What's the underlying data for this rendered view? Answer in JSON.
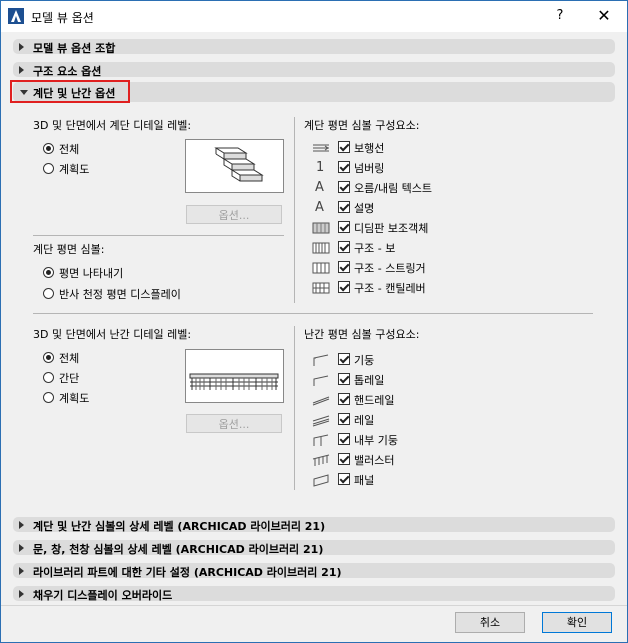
{
  "window": {
    "title": "모델 뷰 옵션",
    "help": "?",
    "close": "✕"
  },
  "sections_top": [
    {
      "label": "모델 뷰 옵션 조합"
    },
    {
      "label": "구조 요소 옵션"
    }
  ],
  "open_section": {
    "label": "계단 및 난간 옵션"
  },
  "stair": {
    "detail_heading": "3D 및 단면에서 계단 디테일 레벨:",
    "detail_options": [
      {
        "label": "전체",
        "selected": true
      },
      {
        "label": "계획도",
        "selected": false
      }
    ],
    "options_button": "옵션...",
    "plan_heading": "계단 평면 심볼:",
    "plan_options": [
      {
        "label": "평면 나타내기",
        "selected": true
      },
      {
        "label": "반사 천정 평면 디스플레이",
        "selected": false
      }
    ],
    "components_heading": "계단 평면 심볼 구성요소:",
    "components": [
      {
        "label": "보행선",
        "checked": true,
        "icon": "walkline-icon"
      },
      {
        "label": "넘버링",
        "checked": true,
        "icon": "numbering-icon"
      },
      {
        "label": "오름/내림 텍스트",
        "checked": true,
        "icon": "updown-text-icon"
      },
      {
        "label": "설명",
        "checked": true,
        "icon": "description-icon"
      },
      {
        "label": "디딤판 보조객체",
        "checked": true,
        "icon": "tread-accessory-icon"
      },
      {
        "label": "구조 - 보",
        "checked": true,
        "icon": "structure-beam-icon"
      },
      {
        "label": "구조 - 스트링거",
        "checked": true,
        "icon": "structure-stringer-icon"
      },
      {
        "label": "구조 - 캔틸레버",
        "checked": true,
        "icon": "structure-cantilever-icon"
      }
    ]
  },
  "railing": {
    "detail_heading": "3D 및 단면에서 난간 디테일 레벨:",
    "detail_options": [
      {
        "label": "전체",
        "selected": true
      },
      {
        "label": "간단",
        "selected": false
      },
      {
        "label": "계획도",
        "selected": false
      }
    ],
    "options_button": "옵션...",
    "components_heading": "난간 평면 심볼 구성요소:",
    "components": [
      {
        "label": "기둥",
        "checked": true,
        "icon": "post-icon"
      },
      {
        "label": "톱레일",
        "checked": true,
        "icon": "toprail-icon"
      },
      {
        "label": "핸드레일",
        "checked": true,
        "icon": "handrail-icon"
      },
      {
        "label": "레일",
        "checked": true,
        "icon": "rail-icon"
      },
      {
        "label": "내부 기둥",
        "checked": true,
        "icon": "inner-post-icon"
      },
      {
        "label": "밸러스터",
        "checked": true,
        "icon": "baluster-icon"
      },
      {
        "label": "패널",
        "checked": true,
        "icon": "panel-icon"
      }
    ]
  },
  "sections_bottom": [
    {
      "label": "계단 및 난간 심볼의 상세 레벨 (ARCHICAD 라이브러리 21)"
    },
    {
      "label": "문, 창, 천창 심볼의 상세 레벨 (ARCHICAD 라이브러리 21)"
    },
    {
      "label": "라이브러리 파트에 대한 기타 설정 (ARCHICAD 라이브러리 21)"
    },
    {
      "label": "채우기 디스플레이 오버라이드"
    }
  ],
  "footer": {
    "cancel": "취소",
    "ok": "확인"
  },
  "colors": {
    "accent": "#0078d7",
    "highlight": "#e02020",
    "section_bg": "#dcdcdc"
  }
}
